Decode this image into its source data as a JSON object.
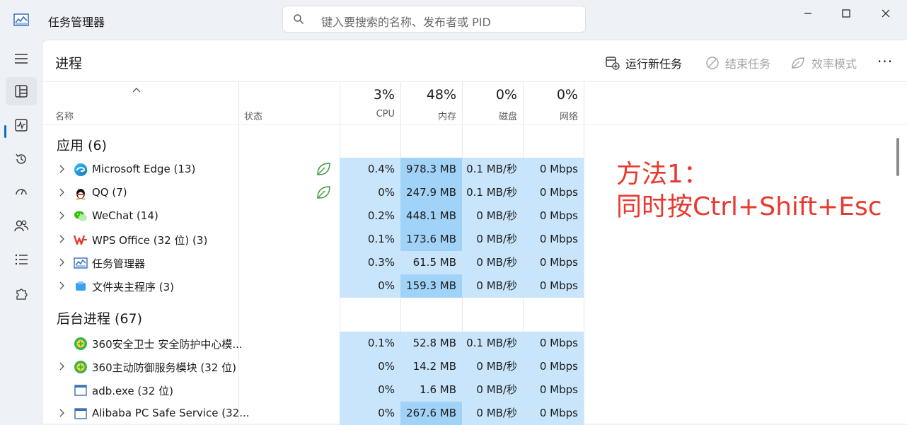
{
  "app": {
    "title": "任务管理器"
  },
  "search": {
    "placeholder": "键入要搜索的名称、发布者或 PID"
  },
  "page": {
    "title": "进程"
  },
  "toolbar": {
    "run_new_task": "运行新任务",
    "end_task": "结束任务",
    "efficiency_mode": "效率模式",
    "more": "···"
  },
  "columns": {
    "name": "名称",
    "status": "状态",
    "cpu": {
      "pct": "3%",
      "label": "CPU"
    },
    "memory": {
      "pct": "48%",
      "label": "内存"
    },
    "disk": {
      "pct": "0%",
      "label": "磁盘"
    },
    "network": {
      "pct": "0%",
      "label": "网络"
    }
  },
  "groups": {
    "apps": "应用 (6)",
    "background": "后台进程 (67)"
  },
  "apps": [
    {
      "name": "Microsoft Edge (13)",
      "cpu": "0.4%",
      "mem": "978.3 MB",
      "disk": "0.1 MB/秒",
      "net": "0 Mbps",
      "efficiency": true,
      "mem_strong": true
    },
    {
      "name": "QQ (7)",
      "cpu": "0%",
      "mem": "247.9 MB",
      "disk": "0.1 MB/秒",
      "net": "0 Mbps",
      "efficiency": true,
      "mem_strong": true
    },
    {
      "name": "WeChat (14)",
      "cpu": "0.2%",
      "mem": "448.1 MB",
      "disk": "0 MB/秒",
      "net": "0 Mbps",
      "efficiency": false,
      "mem_strong": true
    },
    {
      "name": "WPS Office (32 位) (3)",
      "cpu": "0.1%",
      "mem": "173.6 MB",
      "disk": "0 MB/秒",
      "net": "0 Mbps",
      "efficiency": false,
      "mem_strong": true
    },
    {
      "name": "任务管理器",
      "cpu": "0.3%",
      "mem": "61.5 MB",
      "disk": "0 MB/秒",
      "net": "0 Mbps",
      "efficiency": false,
      "mem_strong": false
    },
    {
      "name": "文件夹主程序 (3)",
      "cpu": "0%",
      "mem": "159.3 MB",
      "disk": "0 MB/秒",
      "net": "0 Mbps",
      "efficiency": false,
      "mem_strong": true
    }
  ],
  "background": [
    {
      "name": "360安全卫士 安全防护中心模...",
      "cpu": "0.1%",
      "mem": "52.8 MB",
      "disk": "0.1 MB/秒",
      "net": "0 Mbps",
      "mem_strong": false
    },
    {
      "name": "360主动防御服务模块 (32 位)",
      "cpu": "0%",
      "mem": "14.2 MB",
      "disk": "0 MB/秒",
      "net": "0 Mbps",
      "mem_strong": false
    },
    {
      "name": "adb.exe (32 位)",
      "cpu": "0%",
      "mem": "1.6 MB",
      "disk": "0 MB/秒",
      "net": "0 Mbps",
      "mem_strong": false
    },
    {
      "name": "Alibaba PC Safe Service (32...",
      "cpu": "0%",
      "mem": "267.6 MB",
      "disk": "0 MB/秒",
      "net": "0 Mbps",
      "mem_strong": true
    }
  ],
  "annotation": {
    "line1": "方法1：",
    "line2": "同时按Ctrl+Shift+Esc"
  },
  "colors": {
    "accent": "#0f6cbd",
    "heat_light": "#c9e5fb",
    "heat_strong": "#a1d3f8",
    "annotation": "#e8392e",
    "efficiency_leaf": "#3f9b3f"
  }
}
